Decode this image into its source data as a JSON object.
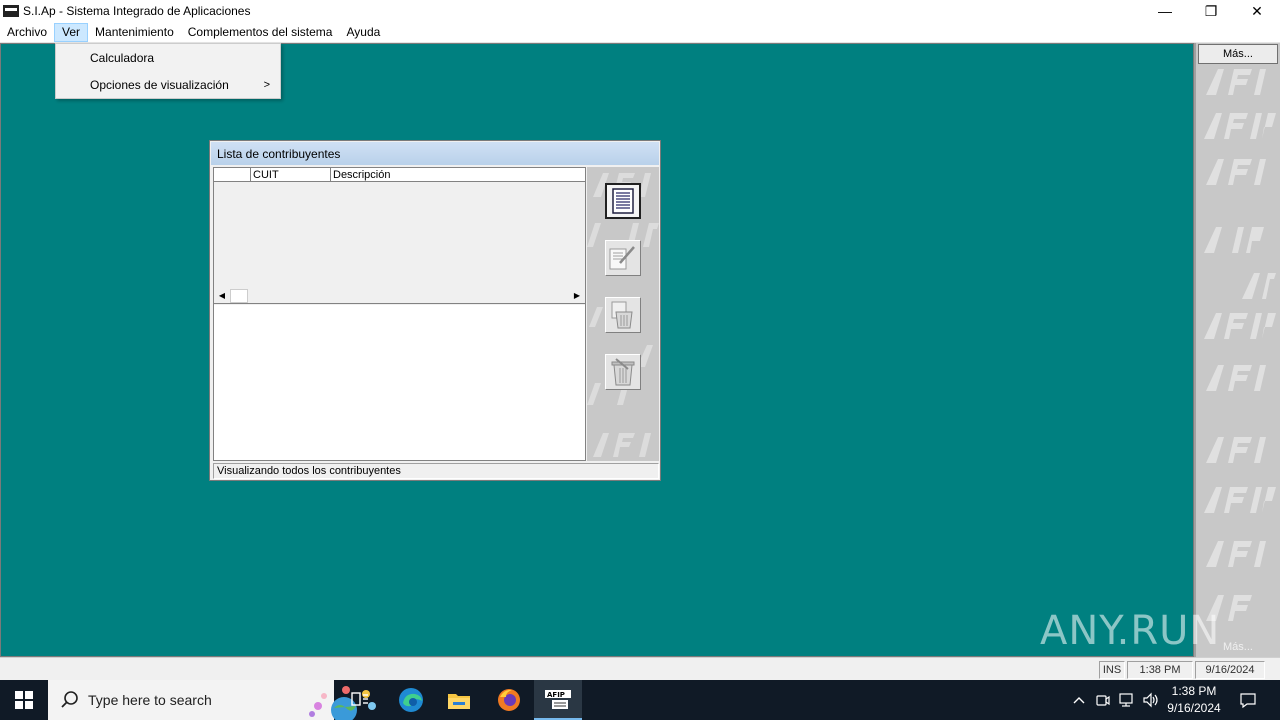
{
  "window": {
    "title": "S.I.Ap - Sistema Integrado de Aplicaciones",
    "minimize_label": "—",
    "maximize_label": "❐",
    "close_label": "✕"
  },
  "menubar": {
    "items": [
      "Archivo",
      "Ver",
      "Mantenimiento",
      "Complementos del sistema",
      "Ayuda"
    ]
  },
  "ver_menu": {
    "items": [
      "Calculadora",
      "Opciones de visualización"
    ],
    "submenu_arrow": ">"
  },
  "sidebar": {
    "top_button": "Más...",
    "bottom_button": "Más..."
  },
  "contribuyentes_window": {
    "title": "Lista de contribuyentes",
    "columns": [
      "",
      "CUIT",
      "Descripción"
    ],
    "status": "Visualizando todos los contribuyentes"
  },
  "app_status": {
    "mode": "INS",
    "time": "1:38 PM",
    "date": "9/16/2024"
  },
  "watermark": "ANY.RUN",
  "taskbar": {
    "search_placeholder": "Type here to search",
    "clock_time": "1:38 PM",
    "clock_date": "9/16/2024"
  },
  "colors": {
    "workspace": "#008080",
    "sidebar": "#c8c8c8",
    "taskbar": "#101a26"
  }
}
